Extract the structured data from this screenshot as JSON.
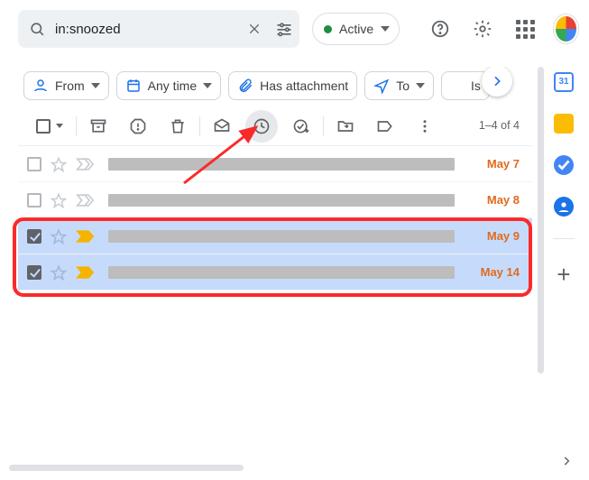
{
  "search": {
    "value": "in:snoozed"
  },
  "active_chip": {
    "label": "Active"
  },
  "chips": {
    "from": "From",
    "anytime": "Any time",
    "attach": "Has attachment",
    "to": "To",
    "overflow": "Is"
  },
  "toolbar": {
    "count": "1–4 of 4"
  },
  "rows": [
    {
      "date": "May 7"
    },
    {
      "date": "May 8"
    },
    {
      "date": "May 9"
    },
    {
      "date": "May 14"
    }
  ]
}
